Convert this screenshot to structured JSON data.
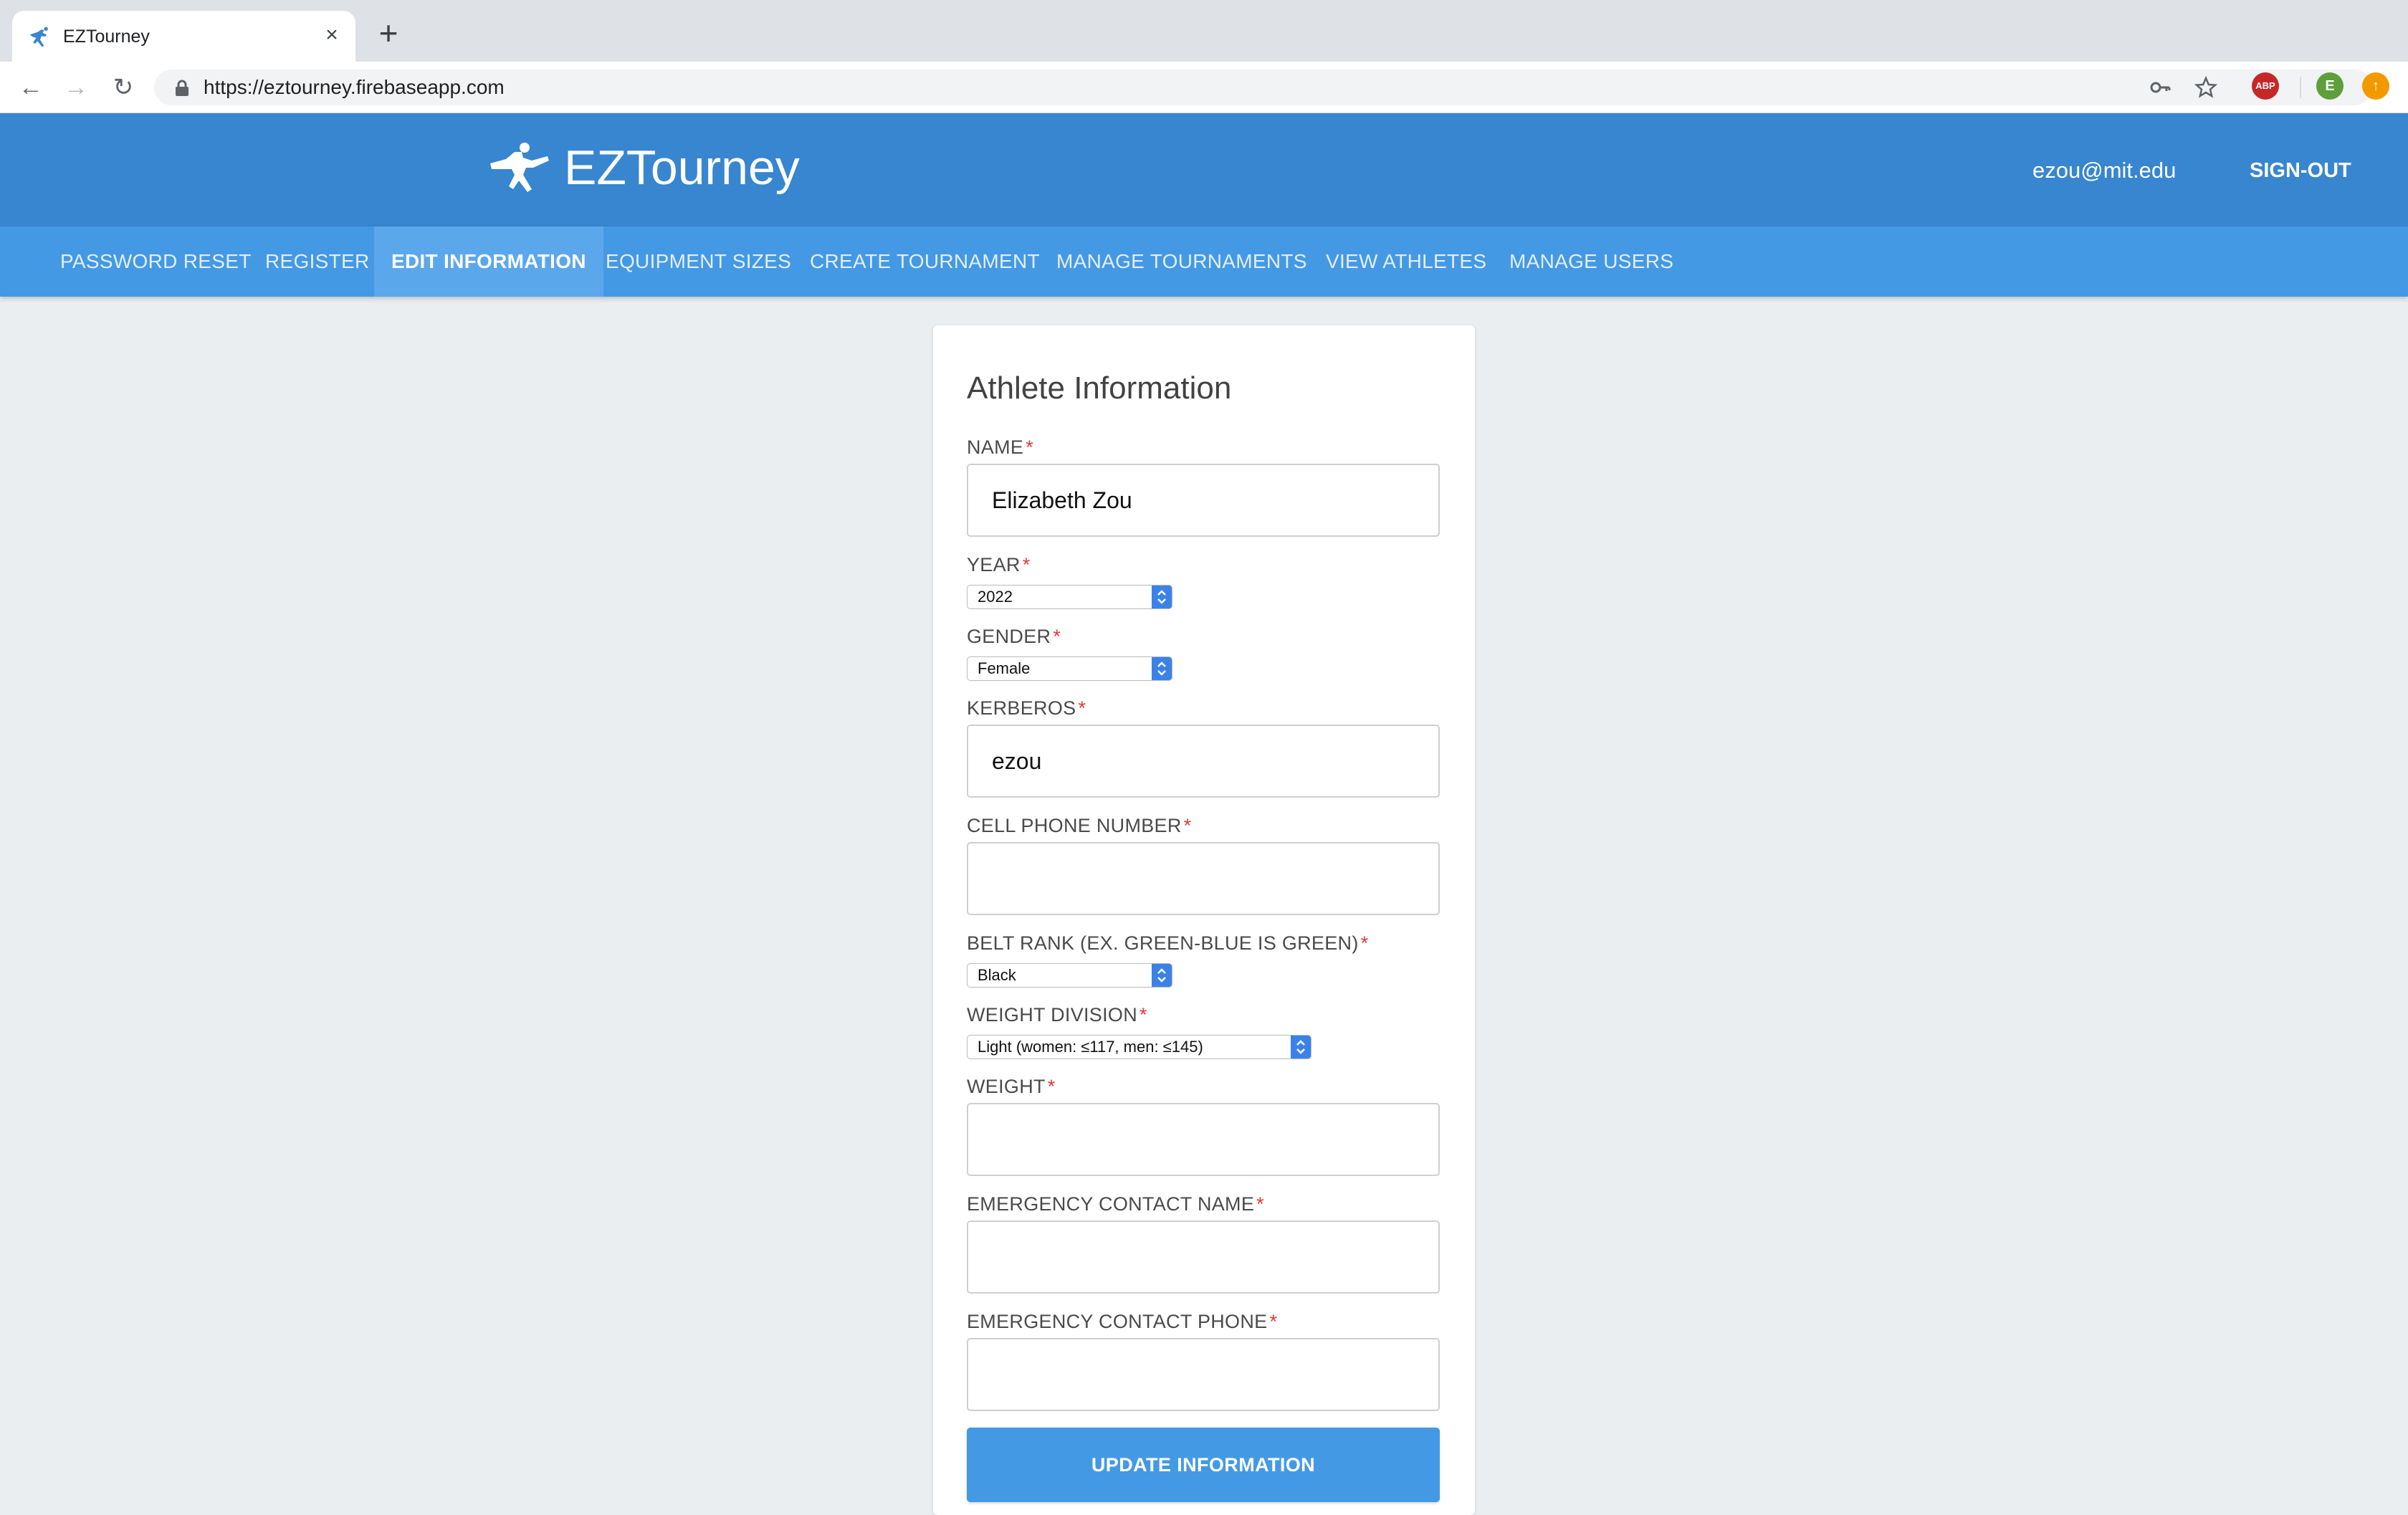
{
  "browser": {
    "tab_title": "EZTourney",
    "tab_close": "×",
    "new_tab": "+",
    "url": "https://eztourney.firebaseapp.com",
    "extensions": [
      {
        "name": "adblock",
        "text": "ABP",
        "color": "#c62828"
      },
      {
        "name": "profile",
        "text": "E",
        "color": "#5e9e3b"
      },
      {
        "name": "update",
        "text": "",
        "color": "#f29900"
      }
    ]
  },
  "header": {
    "title": "EZTourney",
    "user_email": "ezou@mit.edu",
    "signout": "SIGN-OUT"
  },
  "nav": {
    "items": [
      {
        "label": "PASSWORD RESET"
      },
      {
        "label": "REGISTER"
      },
      {
        "label": "EDIT INFORMATION"
      },
      {
        "label": "EQUIPMENT SIZES"
      },
      {
        "label": "CREATE TOURNAMENT"
      },
      {
        "label": "MANAGE TOURNAMENTS"
      },
      {
        "label": "VIEW ATHLETES"
      },
      {
        "label": "MANAGE USERS"
      }
    ],
    "active": "EDIT INFORMATION"
  },
  "form": {
    "title": "Athlete Information",
    "required_mark": "*",
    "name": {
      "label": "NAME",
      "value": "Elizabeth Zou"
    },
    "year": {
      "label": "YEAR",
      "value": "2022"
    },
    "gender": {
      "label": "GENDER",
      "value": "Female"
    },
    "kerberos": {
      "label": "KERBEROS",
      "value": "ezou"
    },
    "cell_phone": {
      "label": "CELL PHONE NUMBER",
      "value": ""
    },
    "belt_rank": {
      "label": "BELT RANK (EX. GREEN-BLUE IS GREEN)",
      "value": "Black"
    },
    "weight_division": {
      "label": "WEIGHT DIVISION",
      "value": "Light (women: ≤117, men: ≤145)"
    },
    "weight": {
      "label": "WEIGHT",
      "value": ""
    },
    "emergency_name": {
      "label": "EMERGENCY CONTACT NAME",
      "value": ""
    },
    "emergency_phone": {
      "label": "EMERGENCY CONTACT PHONE",
      "value": ""
    },
    "submit": "UPDATE INFORMATION"
  },
  "colors": {
    "header": "#3786cf",
    "navbar": "#4499e4",
    "nav_active": "#5ba7ec",
    "button": "#4499e4",
    "required": "#e53935"
  }
}
